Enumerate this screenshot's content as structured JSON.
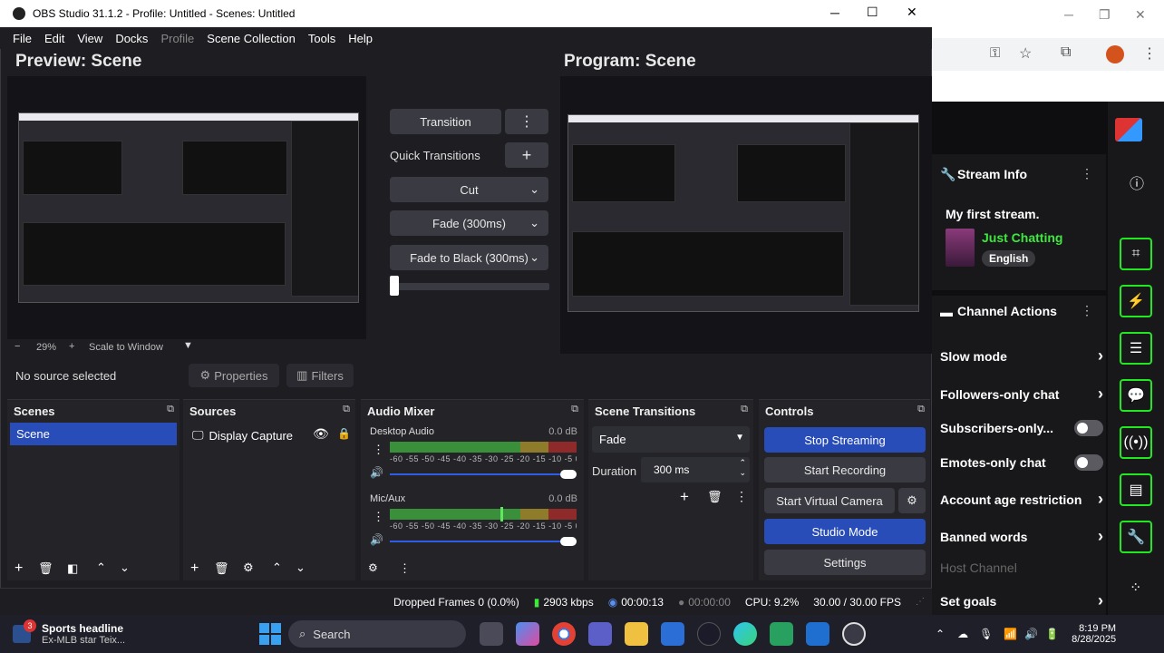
{
  "window": {
    "title": "OBS Studio 31.1.2 - Profile: Untitled - Scenes: Untitled",
    "minimize": "─",
    "maximize": "☐",
    "close": "✕"
  },
  "menu": [
    "File",
    "Edit",
    "View",
    "Docks",
    "Profile",
    "Scene Collection",
    "Tools",
    "Help"
  ],
  "preview": {
    "title": "Preview: Scene",
    "zoom_minus": "−",
    "zoom": "29%",
    "zoom_plus": "+",
    "scale_mode": "Scale to Window"
  },
  "program": {
    "title": "Program: Scene"
  },
  "transitions_center": {
    "transition_btn": "Transition",
    "quick_transitions": "Quick Transitions",
    "options": [
      "Cut",
      "Fade (300ms)",
      "Fade to Black (300ms)"
    ],
    "tbar_fraction": 0.0
  },
  "source_bar": {
    "no_source": "No source selected",
    "properties": "Properties",
    "filters": "Filters"
  },
  "scenes": {
    "title": "Scenes",
    "items": [
      "Scene"
    ]
  },
  "sources": {
    "title": "Sources",
    "items": [
      "Display Capture"
    ]
  },
  "audio_mixer": {
    "title": "Audio Mixer",
    "scale": "-60 -55 -50 -45 -40 -35 -30 -25 -20 -15 -10 -5 0",
    "channels": [
      {
        "name": "Desktop Audio",
        "level": "0.0 dB",
        "volume_fraction": 1.0
      },
      {
        "name": "Mic/Aux",
        "level": "0.0 dB",
        "volume_fraction": 1.0
      }
    ]
  },
  "scene_transitions": {
    "title": "Scene Transitions",
    "selected": "Fade",
    "duration_label": "Duration",
    "duration_value": "300 ms"
  },
  "controls": {
    "title": "Controls",
    "stop_streaming": "Stop Streaming",
    "start_recording": "Start Recording",
    "start_virtual_camera": "Start Virtual Camera",
    "studio_mode": "Studio Mode",
    "settings": "Settings"
  },
  "status": {
    "dropped": "Dropped Frames 0 (0.0%)",
    "bitrate": "2903 kbps",
    "stream_time": "00:00:13",
    "rec_time": "00:00:00",
    "cpu": "CPU: 9.2%",
    "fps": "30.00 / 30.00 FPS"
  },
  "twitch": {
    "stream_info": "Stream Info",
    "stream_title": "My first stream.",
    "category": "Just Chatting",
    "language": "English",
    "channel_actions": "Channel Actions",
    "actions": [
      {
        "label": "Slow mode",
        "kind": "chevron"
      },
      {
        "label": "Followers-only chat",
        "kind": "chevron"
      },
      {
        "label": "Subscribers-only...",
        "kind": "toggle"
      },
      {
        "label": "Emotes-only chat",
        "kind": "toggle"
      },
      {
        "label": "Account age restriction",
        "kind": "chevron"
      },
      {
        "label": "Banned words",
        "kind": "chevron"
      }
    ],
    "host_channel": "Host Channel",
    "set_goals": "Set goals",
    "accent": "#22e822",
    "category_color": "#3ee83e"
  },
  "taskbar": {
    "news_title": "Sports headline",
    "news_sub": "Ex-MLB star Teix...",
    "news_badge": "3",
    "search": "Search",
    "time": "8:19 PM",
    "date": "8/28/2025"
  }
}
